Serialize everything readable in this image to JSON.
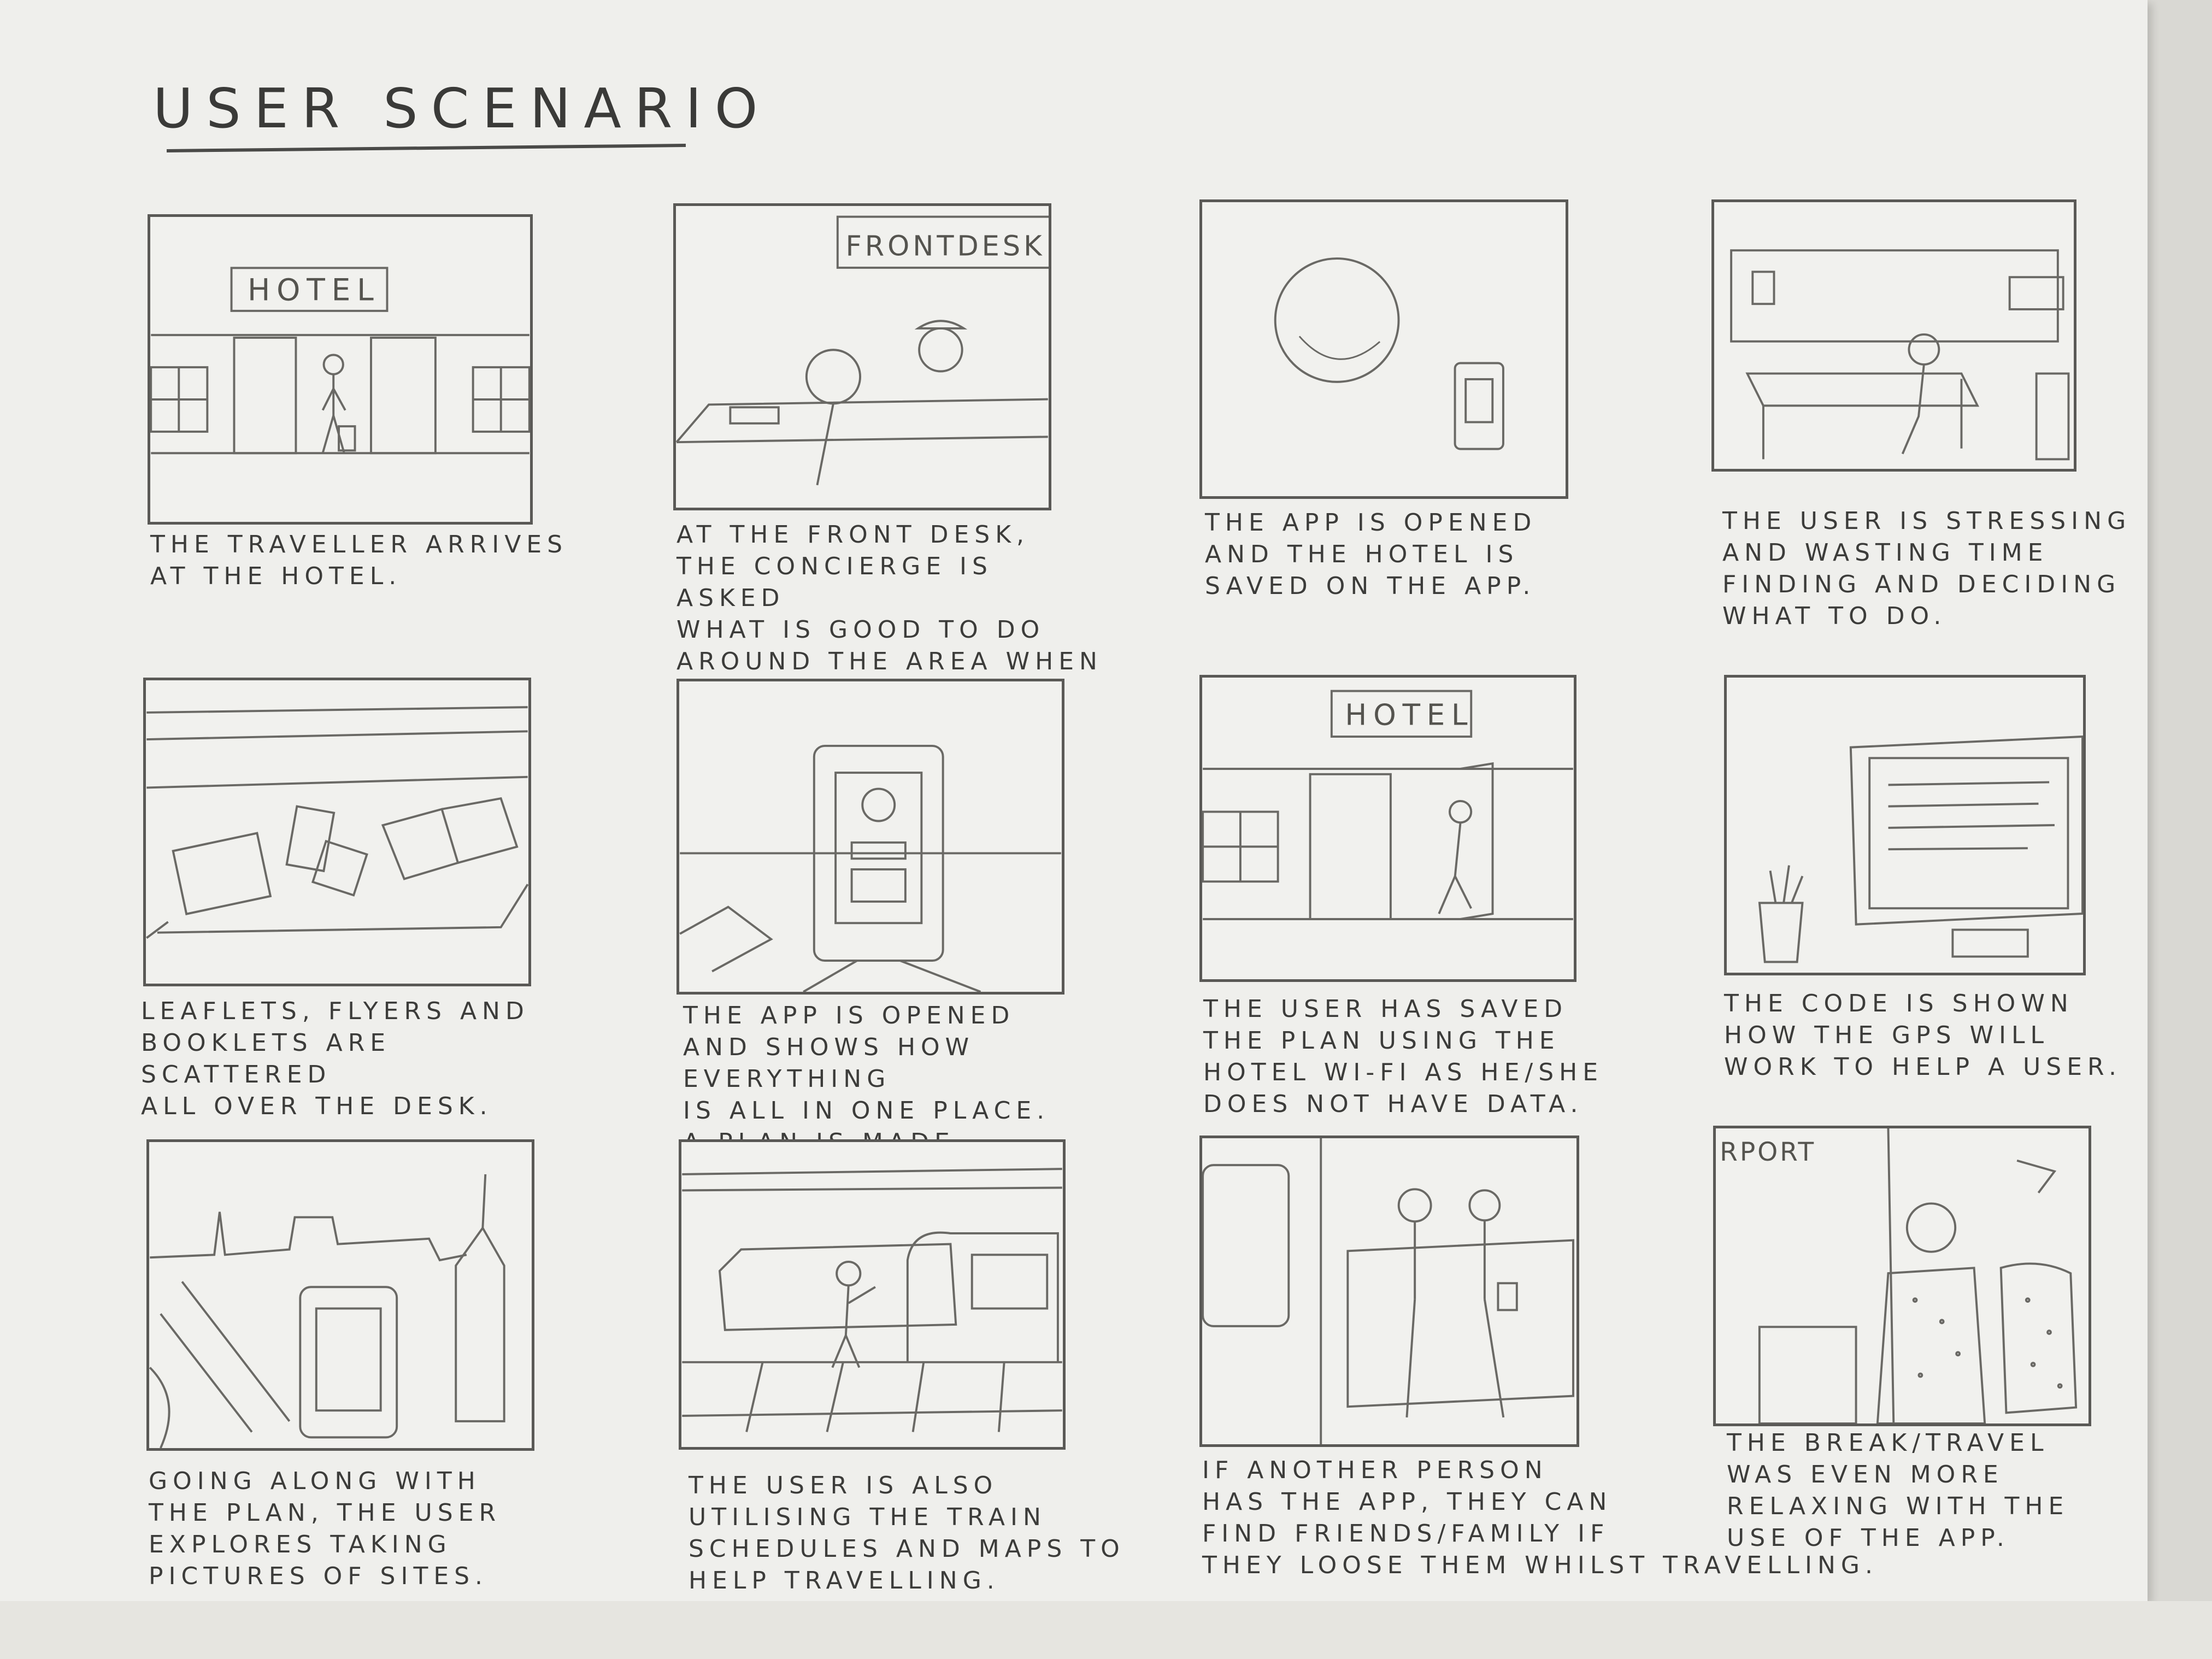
{
  "title": "USER SCENARIO",
  "panels": [
    {
      "caption": "THE TRAVELLER ARRIVES\nAT THE HOTEL.",
      "sign": "HOTEL"
    },
    {
      "caption": "AT THE FRONT DESK,\nTHE CONCIERGE IS ASKED\nWHAT IS GOOD TO DO\nAROUND THE AREA WHEN\nCHECKING IN.",
      "sign": "FRONTDESK"
    },
    {
      "caption": "THE APP IS OPENED\nAND THE HOTEL IS\nSAVED ON THE APP."
    },
    {
      "caption": "THE USER IS STRESSING\nAND WASTING TIME\nFINDING AND DECIDING\nWHAT TO DO."
    },
    {
      "caption": "LEAFLETS, FLYERS AND\nBOOKLETS ARE SCATTERED\nALL OVER THE DESK."
    },
    {
      "caption": "THE APP IS OPENED\nAND SHOWS HOW EVERYTHING\nIS ALL IN ONE PLACE.\nA PLAN IS MADE."
    },
    {
      "caption": "THE USER HAS SAVED\nTHE PLAN USING THE\nHOTEL WI-FI AS HE/SHE\nDOES NOT HAVE DATA.",
      "sign": "HOTEL"
    },
    {
      "caption": "THE CODE IS SHOWN\nHOW THE GPS WILL\nWORK TO HELP A USER."
    },
    {
      "caption": "GOING ALONG WITH\nTHE PLAN, THE USER\nEXPLORES TAKING\nPICTURES OF SITES."
    },
    {
      "caption": "THE USER IS ALSO\nUTILISING THE TRAIN\nSCHEDULES AND MAPS TO\nHELP TRAVELLING."
    },
    {
      "caption": "IF ANOTHER PERSON\nHAS THE APP, THEY CAN\nFIND FRIENDS/FAMILY IF\nTHEY LOOSE THEM WHILST TRAVELLING."
    },
    {
      "caption": "THE BREAK/TRAVEL\nWAS EVEN MORE\nRELAXING WITH THE\nUSE OF THE APP.",
      "sign": "RPORT"
    }
  ]
}
